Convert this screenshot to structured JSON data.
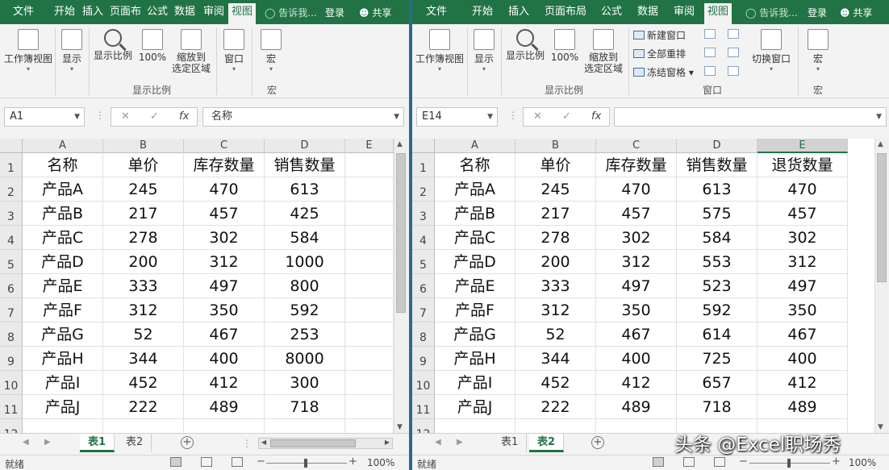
{
  "left": {
    "tabs": [
      "文件",
      "开始",
      "插入",
      "页面布",
      "公式",
      "数据",
      "审阅",
      "视图"
    ],
    "active_tab": "视图",
    "tell_me": "告诉我...",
    "login": "登录",
    "share": "共享",
    "ribbon": {
      "workbook_views": "工作簿视图",
      "show": "显示",
      "zoom": "显示比例",
      "zoom100": "100%",
      "zoom_selection": "缩放到\n选定区域",
      "window": "窗口",
      "macros": "宏",
      "group_zoom": "显示比例",
      "group_macro": "宏"
    },
    "name_box": "A1",
    "formula": "名称",
    "columns": [
      "A",
      "B",
      "C",
      "D",
      "E"
    ],
    "rows": [
      "1",
      "2",
      "3",
      "4",
      "5",
      "6",
      "7",
      "8",
      "9",
      "10",
      "11",
      "12"
    ],
    "headers": [
      "名称",
      "单价",
      "库存数量",
      "销售数量"
    ],
    "data": [
      [
        "产品A",
        "245",
        "470",
        "613"
      ],
      [
        "产品B",
        "217",
        "457",
        "425"
      ],
      [
        "产品C",
        "278",
        "302",
        "584"
      ],
      [
        "产品D",
        "200",
        "312",
        "1000"
      ],
      [
        "产品E",
        "333",
        "497",
        "800"
      ],
      [
        "产品F",
        "312",
        "350",
        "592"
      ],
      [
        "产品G",
        "52",
        "467",
        "253"
      ],
      [
        "产品H",
        "344",
        "400",
        "8000"
      ],
      [
        "产品I",
        "452",
        "412",
        "300"
      ],
      [
        "产品J",
        "222",
        "489",
        "718"
      ]
    ],
    "sheets": [
      "表1",
      "表2"
    ],
    "active_sheet": "表1",
    "status": "就绪",
    "zoom_level": "100%"
  },
  "right": {
    "tabs": [
      "文件",
      "开始",
      "插入",
      "页面布局",
      "公式",
      "数据",
      "审阅",
      "视图"
    ],
    "active_tab": "视图",
    "tell_me": "告诉我...",
    "login": "登录",
    "share": "共享",
    "ribbon": {
      "workbook_views": "工作簿视图",
      "show": "显示",
      "zoom": "显示比例",
      "zoom100": "100%",
      "zoom_selection": "缩放到\n选定区域",
      "new_window": "新建窗口",
      "arrange_all": "全部重排",
      "freeze_panes": "冻结窗格",
      "switch_windows": "切换窗口",
      "macros": "宏",
      "group_zoom": "显示比例",
      "group_window": "窗口",
      "group_macro": "宏"
    },
    "name_box": "E14",
    "formula": "",
    "columns": [
      "A",
      "B",
      "C",
      "D",
      "E"
    ],
    "selected_column": "E",
    "rows": [
      "1",
      "2",
      "3",
      "4",
      "5",
      "6",
      "7",
      "8",
      "9",
      "10",
      "11",
      "12"
    ],
    "headers": [
      "名称",
      "单价",
      "库存数量",
      "销售数量",
      "退货数量"
    ],
    "data": [
      [
        "产品A",
        "245",
        "470",
        "613",
        "470"
      ],
      [
        "产品B",
        "217",
        "457",
        "575",
        "457"
      ],
      [
        "产品C",
        "278",
        "302",
        "584",
        "302"
      ],
      [
        "产品D",
        "200",
        "312",
        "553",
        "312"
      ],
      [
        "产品E",
        "333",
        "497",
        "523",
        "497"
      ],
      [
        "产品F",
        "312",
        "350",
        "592",
        "350"
      ],
      [
        "产品G",
        "52",
        "467",
        "614",
        "467"
      ],
      [
        "产品H",
        "344",
        "400",
        "725",
        "400"
      ],
      [
        "产品I",
        "452",
        "412",
        "657",
        "412"
      ],
      [
        "产品J",
        "222",
        "489",
        "718",
        "489"
      ]
    ],
    "sheets": [
      "表1",
      "表2"
    ],
    "active_sheet": "表2",
    "status": "就绪",
    "zoom_level": "100%"
  },
  "watermark": "头条 @Excel职场秀"
}
